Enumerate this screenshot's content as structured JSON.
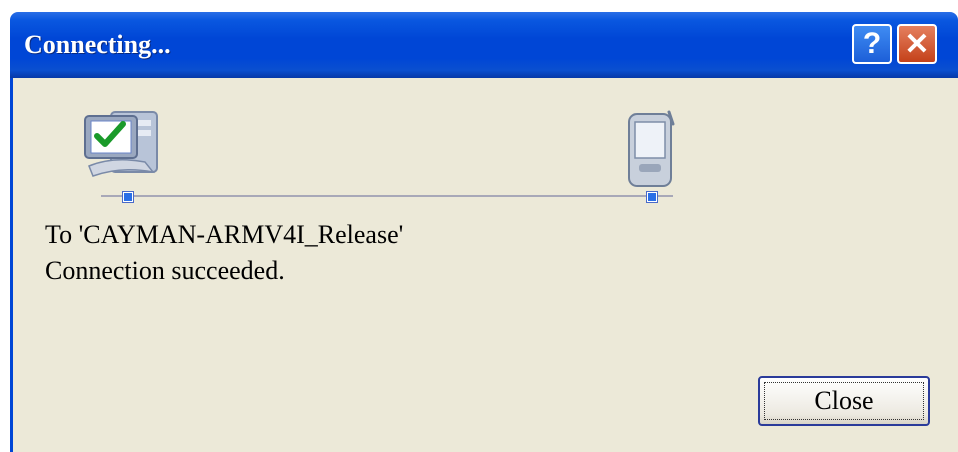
{
  "window": {
    "title": "Connecting...",
    "help_label": "?",
    "close_label": "✕"
  },
  "content": {
    "target_line": "To 'CAYMAN-ARMV4I_Release'",
    "status_line": "Connection succeeded."
  },
  "buttons": {
    "close": "Close"
  },
  "icons": {
    "computer": "computer-check-icon",
    "device": "pocket-pc-device-icon"
  },
  "colors": {
    "titlebar": "#0046d6",
    "client_bg": "#ece9d8",
    "close_title_btn": "#c4411a"
  }
}
